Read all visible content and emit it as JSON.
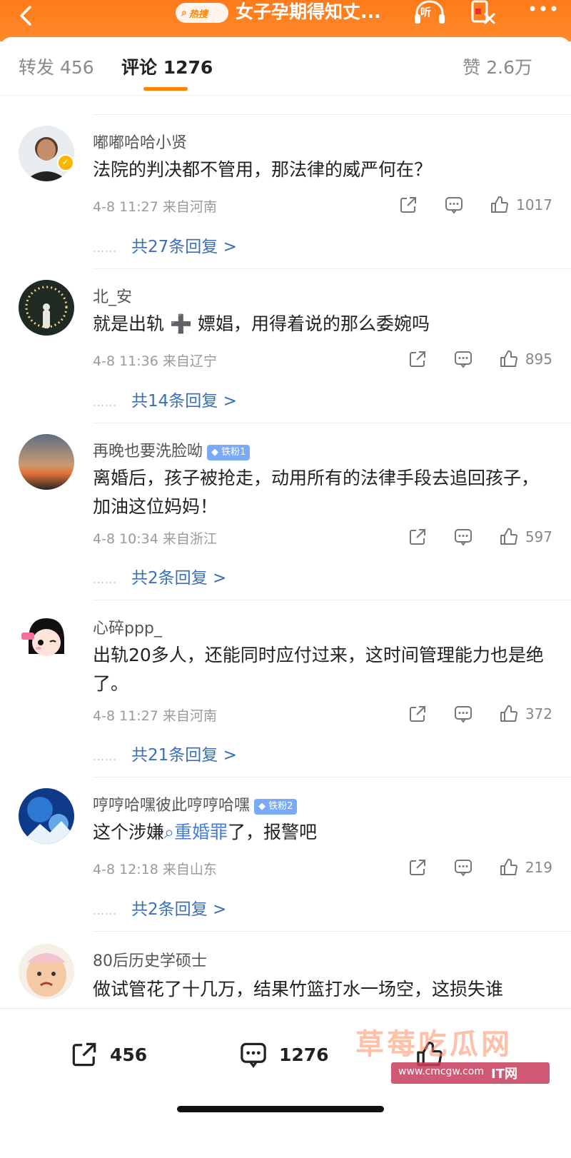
{
  "topbar": {
    "search_tag": "热搜",
    "title": "女子孕期得知丈...",
    "listen_label": "听"
  },
  "tabs": {
    "repost": "转发 456",
    "comments": "评论 1276",
    "likes": "赞 2.6万"
  },
  "comments": [
    {
      "username": "嘟嘟哈哈小贤",
      "verified": true,
      "badge": "",
      "text": "法院的判决都不管用，那法律的威严何在？",
      "time": "4-8 11:27",
      "location": "来自河南",
      "likes": "1017",
      "replies": "共27条回复 >"
    },
    {
      "username": "北_安",
      "verified": false,
      "badge": "",
      "text": "就是出轨 ➕ 嫖娼，用得着说的那么委婉吗",
      "time": "4-8 11:36",
      "location": "来自辽宁",
      "likes": "895",
      "replies": "共14条回复 >"
    },
    {
      "username": "再晚也要洗脸呦",
      "verified": false,
      "badge": "铁粉1",
      "text": "离婚后，孩子被抢走，动用所有的法律手段去追回孩子，加油这位妈妈！",
      "time": "4-8 10:34",
      "location": "来自浙江",
      "likes": "597",
      "replies": "共2条回复 >"
    },
    {
      "username": "心碎ppp_",
      "verified": false,
      "badge": "",
      "text": "出轨20多人，还能同时应付过来，这时间管理能力也是绝了。",
      "time": "4-8 11:27",
      "location": "来自河南",
      "likes": "372",
      "replies": "共21条回复 >"
    },
    {
      "username": "哼哼哈嘿彼此哼哼哈嘿",
      "verified": false,
      "badge": "铁粉2",
      "text_before": "这个涉嫌",
      "text_link": "重婚罪",
      "text_after": "了，报警吧",
      "time": "4-8 12:18",
      "location": "来自山东",
      "likes": "219",
      "replies": "共2条回复 >"
    },
    {
      "username": "80后历史学硕士",
      "verified": false,
      "badge": "",
      "text": "做试管花了十几万，结果竹篮打水一场空，这损失谁"
    }
  ],
  "bottombar": {
    "share_count": "456",
    "comment_count": "1276"
  },
  "watermark": {
    "text": "草莓吃瓜网",
    "url": "www.cmcgw.com",
    "site": "IT网"
  },
  "colors": {
    "brand_orange": "#ff8200",
    "link_blue": "#3b6fb7",
    "fan_badge_blue": "#7aa9f6"
  },
  "icons": [
    "back-icon",
    "search-icon",
    "headphones-icon",
    "red-envelope-icon",
    "more-icon",
    "share-icon",
    "comment-icon",
    "like-icon"
  ]
}
